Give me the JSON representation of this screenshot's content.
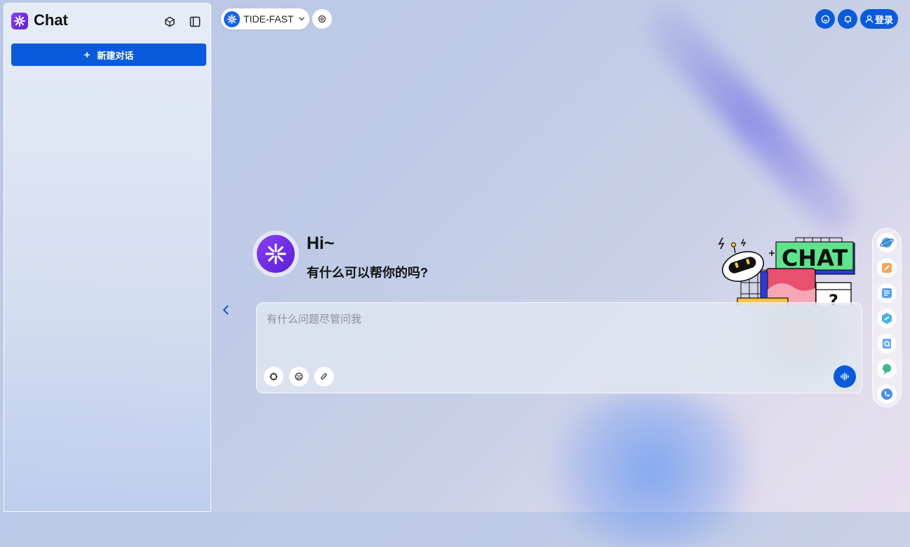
{
  "app": {
    "title": "Chat"
  },
  "sidebar": {
    "new_chat_label": "新建对话",
    "new_chat_icon": "plus-icon"
  },
  "header": {
    "model_name": "TIDE-FAST",
    "login_label": "登录"
  },
  "greeting": {
    "hi": "Hi~",
    "subtitle": "有什么可以帮你的吗?"
  },
  "illustration": {
    "text": "CHAT"
  },
  "input": {
    "placeholder": "有什么问题尽管问我",
    "value": ""
  },
  "colors": {
    "accent": "#0a5bdc",
    "brand": "#6a2ee0"
  },
  "rail_icons": [
    "planet-icon",
    "edit-icon",
    "document-icon",
    "link-icon",
    "search-doc-icon",
    "chat-bubble-icon",
    "phone-icon"
  ]
}
